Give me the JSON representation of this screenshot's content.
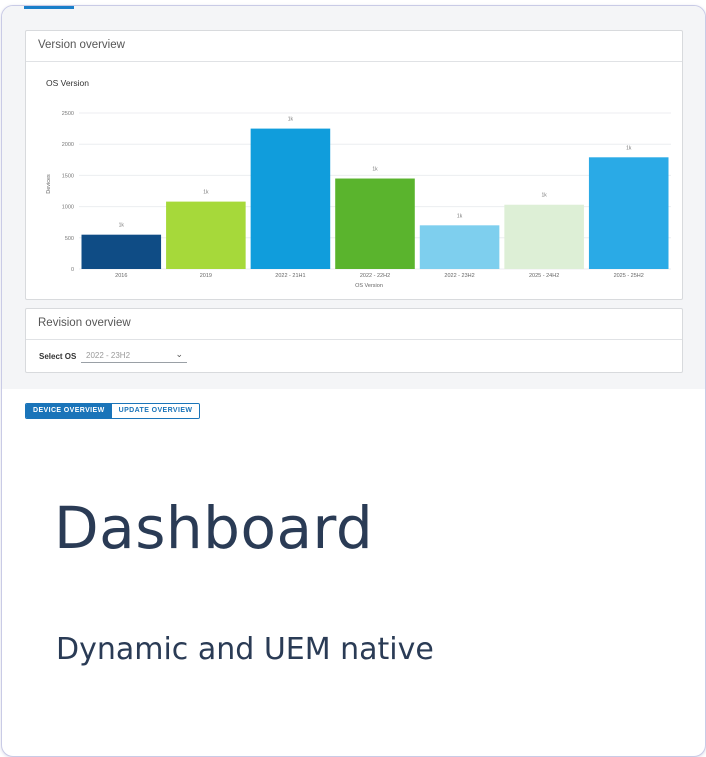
{
  "version_panel": {
    "title": "Version overview"
  },
  "chart_data": {
    "type": "bar",
    "title": "OS Version",
    "xlabel": "OS Version",
    "ylabel": "Devices",
    "ylim": [
      0,
      2500
    ],
    "yticks": [
      0,
      500,
      1000,
      1500,
      2000,
      2500
    ],
    "categories": [
      "2016",
      "2019",
      "2022 - 21H1",
      "2022 - 22H2",
      "2022 - 23H2",
      "2025 - 24H2",
      "2025 - 25H2"
    ],
    "values": [
      550,
      1080,
      2250,
      1450,
      700,
      1030,
      1790
    ],
    "data_labels": [
      "1k",
      "1k",
      "1k",
      "1k",
      "1k",
      "1k",
      "1k"
    ],
    "colors": [
      "#0f4c85",
      "#a6d93a",
      "#109ddc",
      "#5ab42d",
      "#7ecfee",
      "#ddefd6",
      "#2aaae6"
    ],
    "grid": true,
    "legend": "none"
  },
  "revision_panel": {
    "title": "Revision overview",
    "select_label": "Select OS",
    "select_value": "2022 - 23H2"
  },
  "tabs": [
    {
      "label": "DEVICE OVERVIEW",
      "active": true
    },
    {
      "label": "UPDATE OVERVIEW",
      "active": false
    }
  ],
  "headline": "Dashboard",
  "subheadline": "Dynamic and UEM native",
  "icons": {
    "select_chevron": "chevron-down-icon"
  },
  "colors": {
    "accent": "#1a74b9",
    "text": "#2a3b55",
    "border": "#c9cbe6"
  }
}
